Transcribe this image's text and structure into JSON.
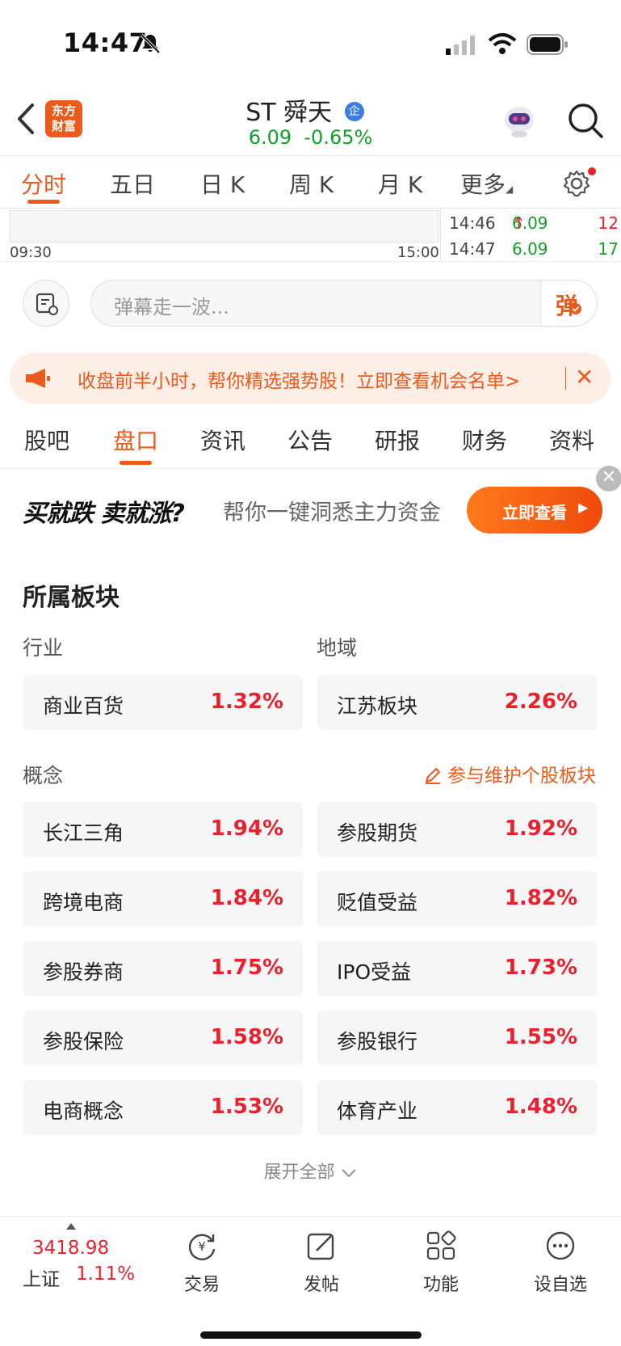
{
  "status_bar": {
    "time": "14:47"
  },
  "header": {
    "logo_text_line1": "东方",
    "logo_text_line2": "财富",
    "stock_name": "ST 舜天",
    "badge": "企",
    "price": "6.09",
    "change": "-0.65%"
  },
  "chart_tabs": [
    "分时",
    "五日",
    "日 K",
    "周 K",
    "月 K",
    "更多"
  ],
  "mini_chart": {
    "start_time": "09:30",
    "end_time": "15:00",
    "ticks": [
      {
        "time": "14:46",
        "price": "6.09",
        "arrow": "↑",
        "volume": "12"
      },
      {
        "time": "14:47",
        "price": "6.09",
        "arrow": "",
        "volume": "17"
      }
    ]
  },
  "danmaku": {
    "placeholder": "弹幕走一波...",
    "send_label": "弹"
  },
  "promo": {
    "text": "收盘前半小时，帮你精选强势股！立即查看机会名单>",
    "close": "✕"
  },
  "section_tabs": [
    "股吧",
    "盘口",
    "资讯",
    "公告",
    "研报",
    "财务",
    "资料"
  ],
  "ad": {
    "slogan": "买就跌 卖就涨?",
    "desc": "帮你一键洞悉主力资金",
    "button": "立即查看",
    "close": "✕"
  },
  "sectors": {
    "title": "所属板块",
    "industry_label": "行业",
    "region_label": "地域",
    "industry": {
      "name": "商业百货",
      "pct": "1.32%"
    },
    "region": {
      "name": "江苏板块",
      "pct": "2.26%"
    },
    "concept_label": "概念",
    "maintain_link": "参与维护个股板块",
    "concepts": [
      {
        "name": "长江三角",
        "pct": "1.94%"
      },
      {
        "name": "参股期货",
        "pct": "1.92%"
      },
      {
        "name": "跨境电商",
        "pct": "1.84%"
      },
      {
        "name": "贬值受益",
        "pct": "1.82%"
      },
      {
        "name": "参股券商",
        "pct": "1.75%"
      },
      {
        "name": "IPO受益",
        "pct": "1.73%"
      },
      {
        "name": "参股保险",
        "pct": "1.58%"
      },
      {
        "name": "参股银行",
        "pct": "1.55%"
      },
      {
        "name": "电商概念",
        "pct": "1.53%"
      },
      {
        "name": "体育产业",
        "pct": "1.48%"
      }
    ],
    "expand_label": "展开全部"
  },
  "bottom_bar": {
    "index_value": "3418.98",
    "index_name": "上证",
    "index_pct": "1.11%",
    "nav": [
      "交易",
      "发帖",
      "功能",
      "设自选"
    ]
  },
  "colors": {
    "accent": "#ec5a1c",
    "up": "#e8222d",
    "down": "#12a02a"
  }
}
